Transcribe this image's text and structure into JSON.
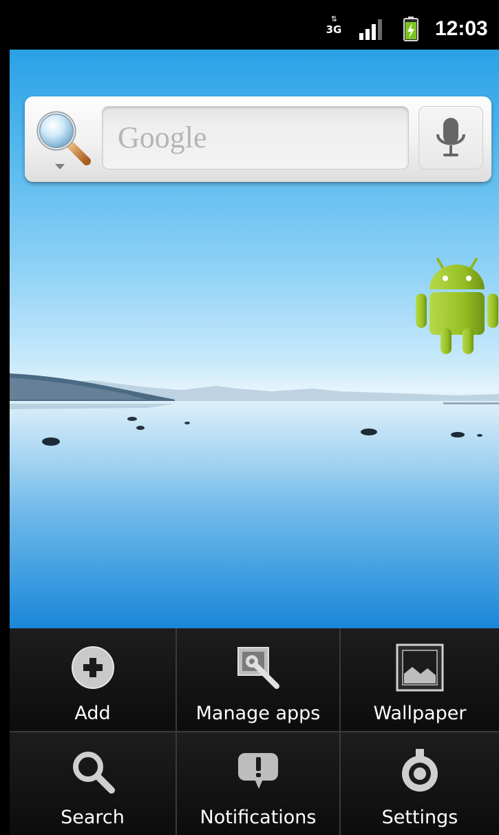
{
  "status_bar": {
    "network_type": "3G",
    "network_arrows": "⇅",
    "time": "12:03",
    "icons": [
      "network-3g-icon",
      "signal-strength-icon",
      "battery-charging-icon"
    ]
  },
  "search_widget": {
    "hint": "Google",
    "icons": [
      "search-engine-icon",
      "microphone-icon"
    ]
  },
  "menu": {
    "items": [
      {
        "label": "Add",
        "icon": "add-icon"
      },
      {
        "label": "Manage apps",
        "icon": "manage-apps-icon"
      },
      {
        "label": "Wallpaper",
        "icon": "wallpaper-icon"
      },
      {
        "label": "Search",
        "icon": "search-icon"
      },
      {
        "label": "Notifications",
        "icon": "notifications-icon"
      },
      {
        "label": "Settings",
        "icon": "settings-icon"
      }
    ]
  },
  "colors": {
    "menu_background": "#0b0b0b",
    "sky_top": "#2aa1e6",
    "android_green": "#97c024"
  }
}
